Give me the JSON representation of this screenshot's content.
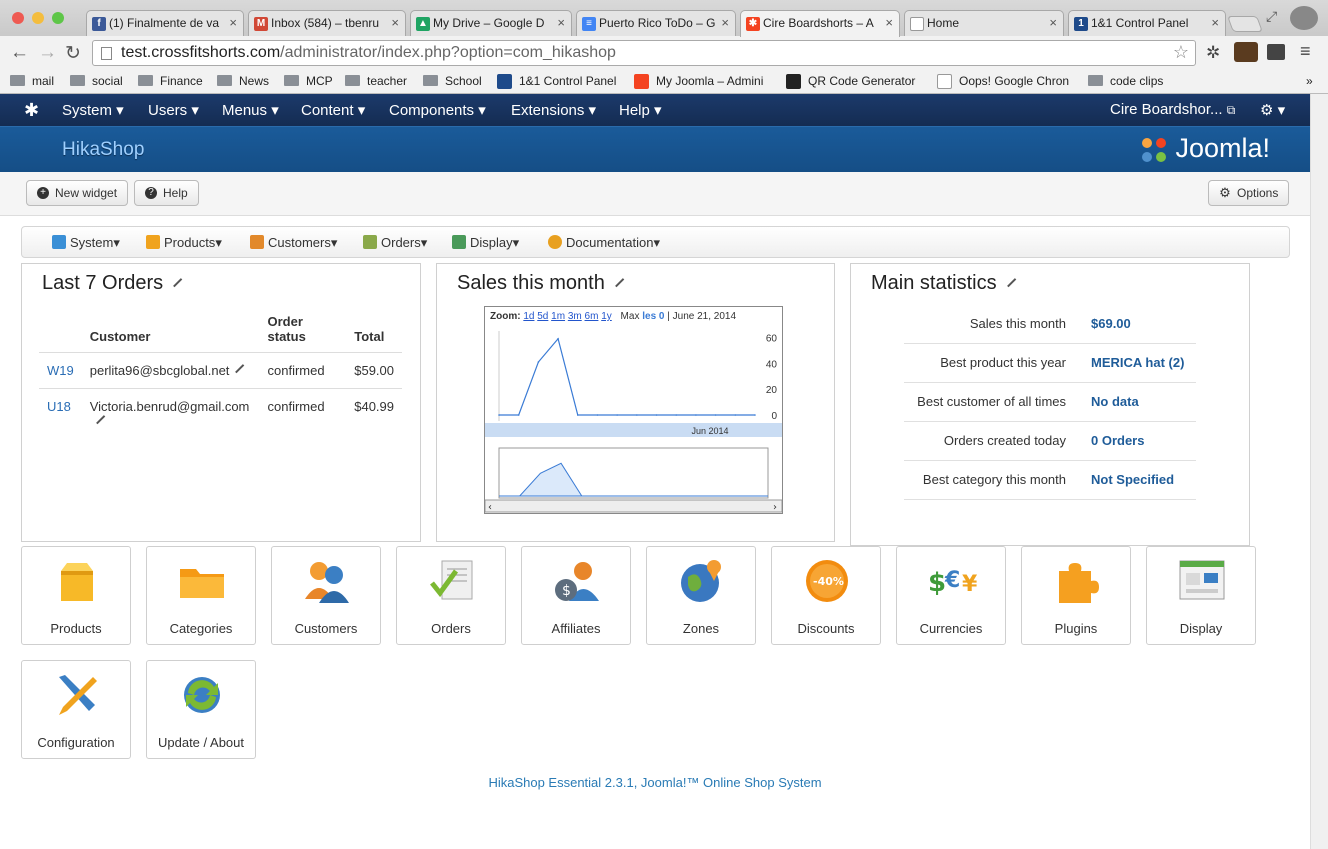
{
  "browser": {
    "tabs": [
      {
        "label": "(1) Finalmente de va",
        "fav": "f",
        "favcolor": "#3b5998"
      },
      {
        "label": "Inbox (584) – tbenru",
        "fav": "M",
        "favcolor": "#d14836"
      },
      {
        "label": "My Drive – Google D",
        "fav": "▲",
        "favcolor": "#1fa463"
      },
      {
        "label": "Puerto Rico ToDo – G",
        "fav": "≡",
        "favcolor": "#4285f4"
      },
      {
        "label": "Cire Boardshorts – A",
        "fav": "✱",
        "favcolor": "#f44321"
      },
      {
        "label": "Home",
        "fav": "",
        "favcolor": "#ffffff"
      },
      {
        "label": "1&1 Control Panel",
        "fav": "1",
        "favcolor": "#1e4a8a"
      }
    ],
    "url_host": "test.crossfitshorts.com",
    "url_path": "/administrator/index.php?option=com_hikashop",
    "bookmarks": [
      {
        "label": "mail",
        "type": "folder"
      },
      {
        "label": "social",
        "type": "folder"
      },
      {
        "label": "Finance",
        "type": "folder"
      },
      {
        "label": "News",
        "type": "folder"
      },
      {
        "label": "MCP",
        "type": "folder"
      },
      {
        "label": "teacher",
        "type": "folder"
      },
      {
        "label": "School",
        "type": "folder"
      },
      {
        "label": "1&1 Control Panel",
        "type": "link"
      },
      {
        "label": "My Joomla – Admini",
        "type": "link"
      },
      {
        "label": "QR Code Generator",
        "type": "link"
      },
      {
        "label": "Oops! Google Chron",
        "type": "link"
      },
      {
        "label": "code clips",
        "type": "folder"
      }
    ]
  },
  "joomla": {
    "menu": [
      "System",
      "Users",
      "Menus",
      "Content",
      "Components",
      "Extensions",
      "Help"
    ],
    "site_name": "Cire Boardshor...",
    "component_title": "HikaShop",
    "logo_text": "Joomla!"
  },
  "actions": {
    "new_widget": "New widget",
    "help": "Help",
    "options": "Options"
  },
  "hikamenu": [
    {
      "label": "System",
      "color": "#3a8fd6"
    },
    {
      "label": "Products",
      "color": "#f0a31e"
    },
    {
      "label": "Customers",
      "color": "#e2892b"
    },
    {
      "label": "Orders",
      "color": "#8aa94a"
    },
    {
      "label": "Display",
      "color": "#4a9a5a"
    },
    {
      "label": "Documentation",
      "color": "#e8a020"
    }
  ],
  "orders": {
    "title": "Last 7 Orders",
    "headers": [
      "Customer",
      "Order status",
      "Total"
    ],
    "rows": [
      {
        "id": "W19",
        "customer": "perlita96@sbcglobal.net",
        "status": "confirmed",
        "total": "$59.00"
      },
      {
        "id": "U18",
        "customer": "Victoria.benrud@gmail.com",
        "status": "confirmed",
        "total": "$40.99"
      }
    ]
  },
  "sales": {
    "title": "Sales this month",
    "zoom_label": "Zoom:",
    "zoom_options": [
      "1d",
      "5d",
      "1m",
      "3m",
      "6m",
      "1y"
    ],
    "max_label": "Max",
    "series_label": "les 0",
    "date": "June 21, 2014",
    "x_label": "Jun 2014"
  },
  "chart_data": {
    "type": "line",
    "x": [
      "2014-06-17",
      "2014-06-18",
      "2014-06-19",
      "2014-06-20",
      "2014-06-21",
      "2014-06-22",
      "2014-06-23",
      "2014-06-24",
      "2014-06-25",
      "2014-06-26",
      "2014-06-27",
      "2014-06-28",
      "2014-06-29",
      "2014-06-30"
    ],
    "series": [
      {
        "name": "",
        "values": [
          0,
          0,
          40.99,
          59,
          0,
          0,
          0,
          0,
          0,
          0,
          0,
          0,
          0,
          0
        ]
      }
    ],
    "yticks": [
      0,
      20,
      40,
      60
    ],
    "ylim": [
      0,
      65
    ],
    "xlabel": "Jun 2014",
    "grid": false
  },
  "stats": {
    "title": "Main statistics",
    "rows": [
      {
        "label": "Sales this month",
        "value": "$69.00"
      },
      {
        "label": "Best product this year",
        "value": "MERICA hat (2)"
      },
      {
        "label": "Best customer of all times",
        "value": "No data"
      },
      {
        "label": "Orders created today",
        "value": "0 Orders"
      },
      {
        "label": "Best category this month",
        "value": "Not Specified"
      }
    ]
  },
  "tiles": [
    {
      "label": "Products",
      "icon": "box-icon"
    },
    {
      "label": "Categories",
      "icon": "folder-icon"
    },
    {
      "label": "Customers",
      "icon": "users-icon"
    },
    {
      "label": "Orders",
      "icon": "orders-icon"
    },
    {
      "label": "Affiliates",
      "icon": "affiliates-icon"
    },
    {
      "label": "Zones",
      "icon": "globe-icon"
    },
    {
      "label": "Discounts",
      "icon": "discount-icon"
    },
    {
      "label": "Currencies",
      "icon": "currencies-icon"
    },
    {
      "label": "Plugins",
      "icon": "puzzle-icon"
    },
    {
      "label": "Display",
      "icon": "display-icon"
    },
    {
      "label": "Configuration",
      "icon": "tools-icon"
    },
    {
      "label": "Update / About",
      "icon": "update-icon"
    }
  ],
  "footer": "HikaShop Essential 2.3.1, Joomla!™ Online Shop System"
}
